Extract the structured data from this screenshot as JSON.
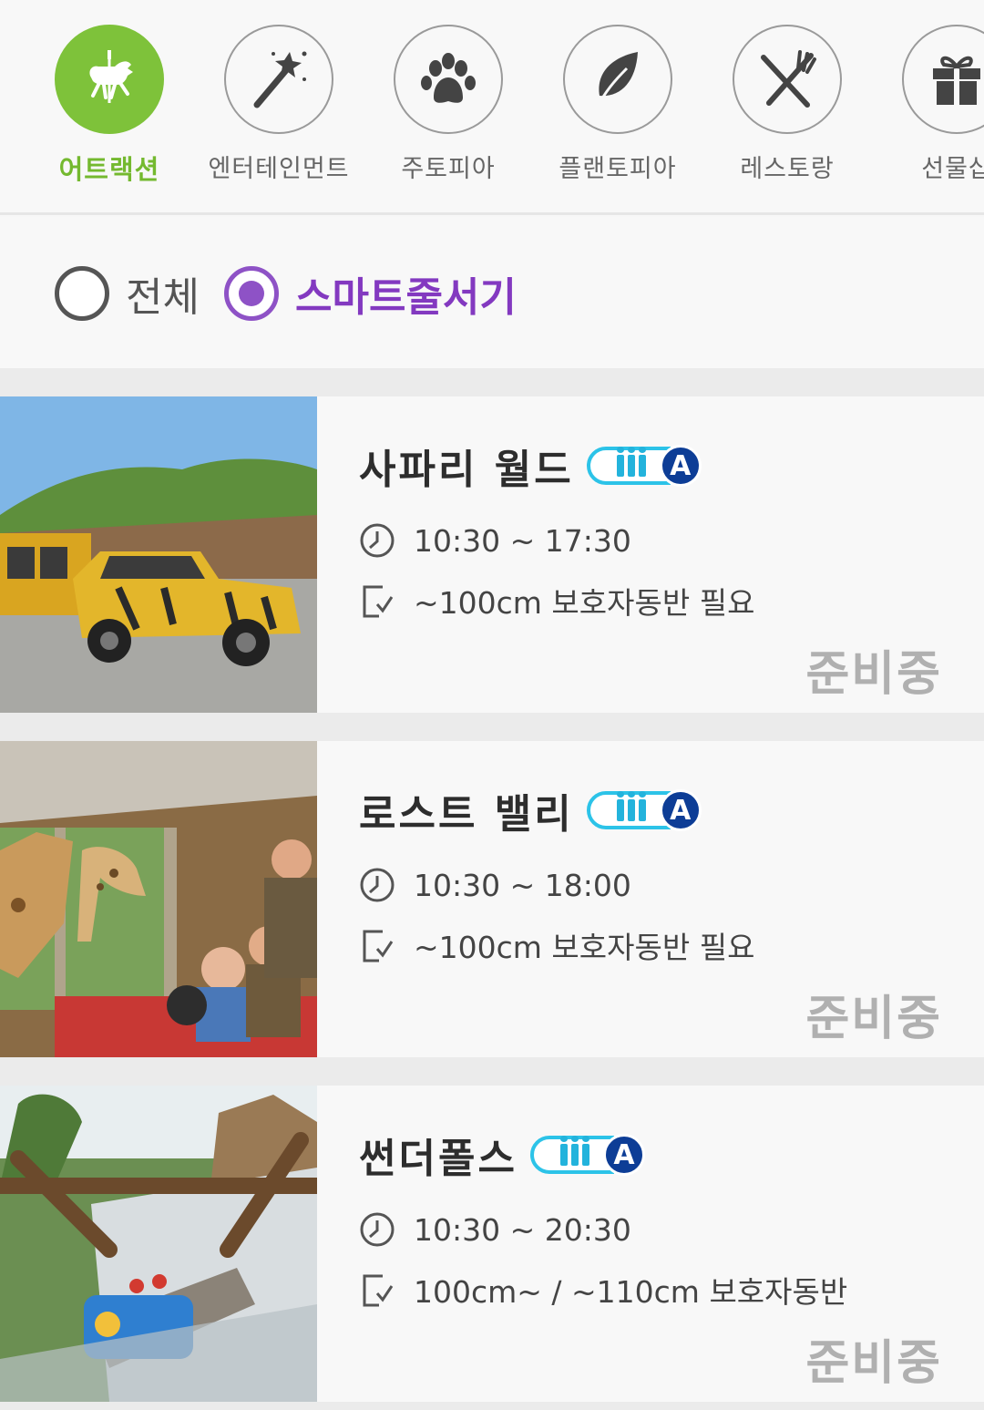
{
  "categories": [
    {
      "label": "어트랙션",
      "icon": "carousel-horse-icon",
      "active": true
    },
    {
      "label": "엔터테인먼트",
      "icon": "magic-wand-icon",
      "active": false
    },
    {
      "label": "주토피아",
      "icon": "paw-icon",
      "active": false
    },
    {
      "label": "플랜토피아",
      "icon": "leaf-icon",
      "active": false
    },
    {
      "label": "레스토랑",
      "icon": "fork-knife-icon",
      "active": false
    },
    {
      "label": "선물샵",
      "icon": "gift-icon",
      "active": false
    }
  ],
  "filter": {
    "all_label": "전체",
    "smart_label": "스마트줄서기",
    "selected": "smart"
  },
  "badge_letter": "A",
  "attractions": [
    {
      "name": "사파리 월드",
      "hours": "10:30 ~ 17:30",
      "requirement": "~100cm 보호자동반 필요",
      "status": "준비중",
      "image": "safari-truck-photo"
    },
    {
      "name": "로스트 밸리",
      "hours": "10:30 ~ 18:00",
      "requirement": "~100cm 보호자동반 필요",
      "status": "준비중",
      "image": "giraffe-bus-photo"
    },
    {
      "name": "썬더폴스",
      "hours": "10:30 ~ 20:30",
      "requirement": "100cm~ / ~110cm 보호자동반",
      "status": "준비중",
      "image": "water-ride-photo"
    }
  ],
  "colors": {
    "accent_green": "#7ec23a",
    "accent_purple": "#8e52c6",
    "badge_blue": "#0d3d96",
    "badge_cyan": "#2cc3e8"
  }
}
